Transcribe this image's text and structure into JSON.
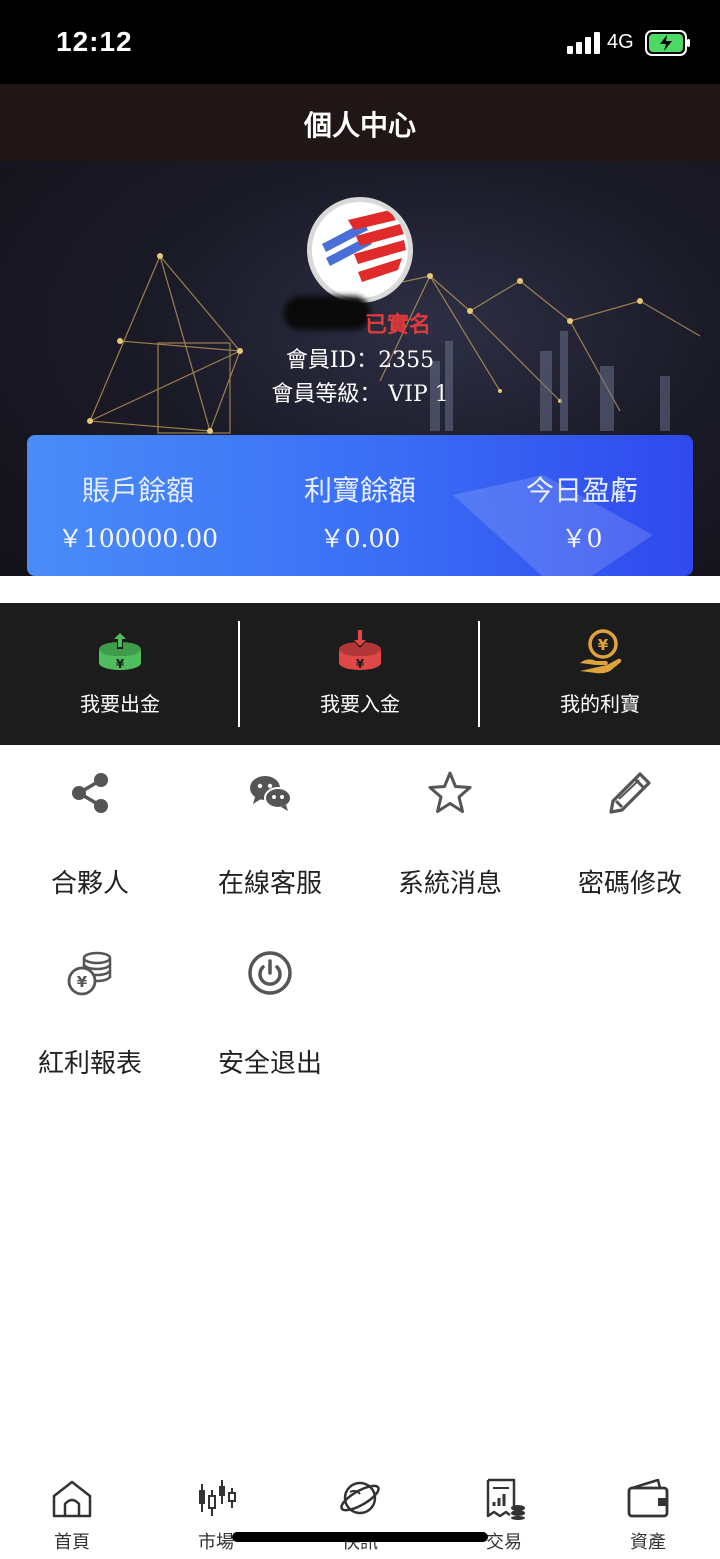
{
  "status_bar": {
    "time": "12:12",
    "network": "4G"
  },
  "header": {
    "title": "個人中心"
  },
  "profile": {
    "verified_label": "已實名",
    "member_id": "會員ID：2355",
    "member_level": "會員等級： VIP 1"
  },
  "balances": [
    {
      "label": "賬戶餘額",
      "value": "￥100000.00"
    },
    {
      "label": "利寶餘額",
      "value": "￥0.00"
    },
    {
      "label": "今日盈虧",
      "value": "￥0"
    }
  ],
  "actions": [
    {
      "label": "我要出金",
      "icon": "withdraw-icon",
      "color": "#4fbd5e"
    },
    {
      "label": "我要入金",
      "icon": "deposit-icon",
      "color": "#e04848"
    },
    {
      "label": "我的利寶",
      "icon": "yuan-hand-icon",
      "color": "#e0a33b"
    }
  ],
  "menu": [
    {
      "label": "合夥人",
      "icon": "share-icon"
    },
    {
      "label": "在線客服",
      "icon": "wechat-icon"
    },
    {
      "label": "系統消息",
      "icon": "star-icon"
    },
    {
      "label": "密碼修改",
      "icon": "pencil-icon"
    },
    {
      "label": "紅利報表",
      "icon": "coins-icon"
    },
    {
      "label": "安全退出",
      "icon": "power-icon"
    }
  ],
  "tabs": [
    {
      "label": "首頁",
      "icon": "home-icon"
    },
    {
      "label": "市場",
      "icon": "candlestick-icon"
    },
    {
      "label": "快訊",
      "icon": "planet-icon"
    },
    {
      "label": "交易",
      "icon": "trade-report-icon"
    },
    {
      "label": "資產",
      "icon": "wallet-icon"
    }
  ]
}
